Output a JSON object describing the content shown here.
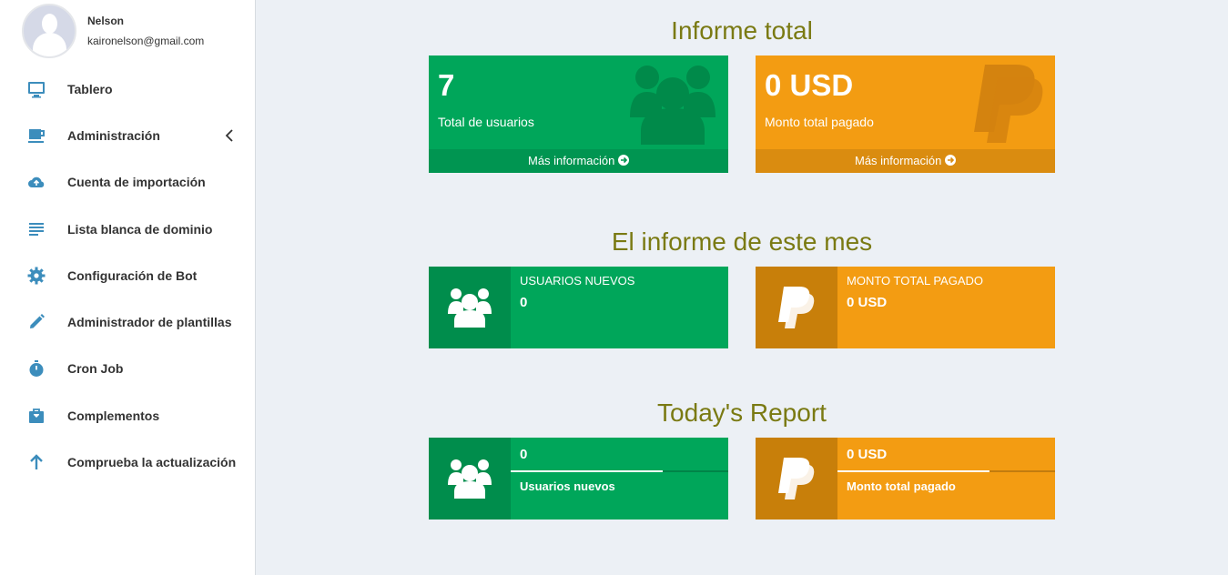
{
  "user": {
    "name": "Nelson",
    "email": "kaironelson@gmail.com"
  },
  "menu": [
    {
      "label": "Tablero",
      "icon": "monitor-icon"
    },
    {
      "label": "Administración",
      "icon": "coffee-cup-icon",
      "has_chevron": true
    },
    {
      "label": "Cuenta de importación",
      "icon": "cloud-upload-icon"
    },
    {
      "label": "Lista blanca de dominio",
      "icon": "list-icon"
    },
    {
      "label": "Configuración de Bot",
      "icon": "gear-icon"
    },
    {
      "label": "Administrador de plantillas",
      "icon": "pencil-icon"
    },
    {
      "label": "Cron Job",
      "icon": "stopwatch-icon"
    },
    {
      "label": "Complementos",
      "icon": "briefcase-icon"
    },
    {
      "label": "Comprueba la actualización",
      "icon": "arrow-up-icon"
    }
  ],
  "total_report": {
    "title": "Informe total",
    "users": {
      "value": "7",
      "label": "Total de usuarios",
      "footer": "Más información"
    },
    "paid": {
      "value": "0 USD",
      "label": "Monto total pagado",
      "footer": "Más información"
    }
  },
  "month_report": {
    "title": "El informe de este mes",
    "users": {
      "label": "USUARIOS NUEVOS",
      "value": "0"
    },
    "paid": {
      "label": "MONTO TOTAL PAGADO",
      "value": "0 USD"
    }
  },
  "today_report": {
    "title": "Today's Report",
    "users": {
      "value": "0",
      "label": "Usuarios nuevos",
      "progress": 0.7
    },
    "paid": {
      "value": "0 USD",
      "label": "Monto total pagado",
      "progress": 0.7
    }
  },
  "colors": {
    "accent_blue": "#3c8dbc",
    "green": "#00a65a",
    "orange": "#f39c12",
    "title_olive": "#7a7a13"
  }
}
